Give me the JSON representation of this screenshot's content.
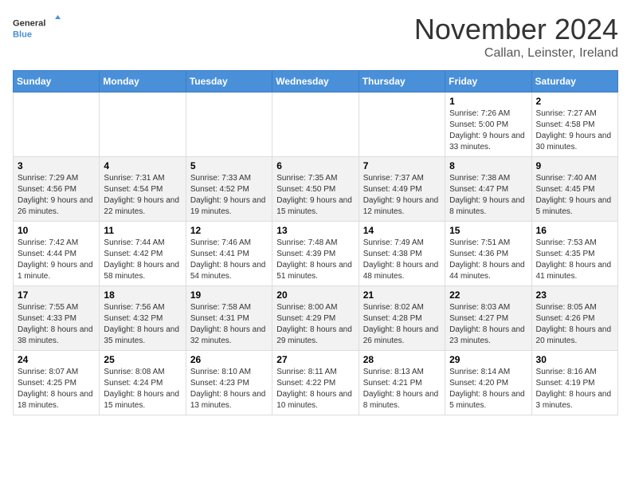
{
  "logo": {
    "line1": "General",
    "line2": "Blue"
  },
  "title": "November 2024",
  "subtitle": "Callan, Leinster, Ireland",
  "days_of_week": [
    "Sunday",
    "Monday",
    "Tuesday",
    "Wednesday",
    "Thursday",
    "Friday",
    "Saturday"
  ],
  "weeks": [
    [
      {
        "day": "",
        "info": ""
      },
      {
        "day": "",
        "info": ""
      },
      {
        "day": "",
        "info": ""
      },
      {
        "day": "",
        "info": ""
      },
      {
        "day": "",
        "info": ""
      },
      {
        "day": "1",
        "info": "Sunrise: 7:26 AM\nSunset: 5:00 PM\nDaylight: 9 hours and 33 minutes."
      },
      {
        "day": "2",
        "info": "Sunrise: 7:27 AM\nSunset: 4:58 PM\nDaylight: 9 hours and 30 minutes."
      }
    ],
    [
      {
        "day": "3",
        "info": "Sunrise: 7:29 AM\nSunset: 4:56 PM\nDaylight: 9 hours and 26 minutes."
      },
      {
        "day": "4",
        "info": "Sunrise: 7:31 AM\nSunset: 4:54 PM\nDaylight: 9 hours and 22 minutes."
      },
      {
        "day": "5",
        "info": "Sunrise: 7:33 AM\nSunset: 4:52 PM\nDaylight: 9 hours and 19 minutes."
      },
      {
        "day": "6",
        "info": "Sunrise: 7:35 AM\nSunset: 4:50 PM\nDaylight: 9 hours and 15 minutes."
      },
      {
        "day": "7",
        "info": "Sunrise: 7:37 AM\nSunset: 4:49 PM\nDaylight: 9 hours and 12 minutes."
      },
      {
        "day": "8",
        "info": "Sunrise: 7:38 AM\nSunset: 4:47 PM\nDaylight: 9 hours and 8 minutes."
      },
      {
        "day": "9",
        "info": "Sunrise: 7:40 AM\nSunset: 4:45 PM\nDaylight: 9 hours and 5 minutes."
      }
    ],
    [
      {
        "day": "10",
        "info": "Sunrise: 7:42 AM\nSunset: 4:44 PM\nDaylight: 9 hours and 1 minute."
      },
      {
        "day": "11",
        "info": "Sunrise: 7:44 AM\nSunset: 4:42 PM\nDaylight: 8 hours and 58 minutes."
      },
      {
        "day": "12",
        "info": "Sunrise: 7:46 AM\nSunset: 4:41 PM\nDaylight: 8 hours and 54 minutes."
      },
      {
        "day": "13",
        "info": "Sunrise: 7:48 AM\nSunset: 4:39 PM\nDaylight: 8 hours and 51 minutes."
      },
      {
        "day": "14",
        "info": "Sunrise: 7:49 AM\nSunset: 4:38 PM\nDaylight: 8 hours and 48 minutes."
      },
      {
        "day": "15",
        "info": "Sunrise: 7:51 AM\nSunset: 4:36 PM\nDaylight: 8 hours and 44 minutes."
      },
      {
        "day": "16",
        "info": "Sunrise: 7:53 AM\nSunset: 4:35 PM\nDaylight: 8 hours and 41 minutes."
      }
    ],
    [
      {
        "day": "17",
        "info": "Sunrise: 7:55 AM\nSunset: 4:33 PM\nDaylight: 8 hours and 38 minutes."
      },
      {
        "day": "18",
        "info": "Sunrise: 7:56 AM\nSunset: 4:32 PM\nDaylight: 8 hours and 35 minutes."
      },
      {
        "day": "19",
        "info": "Sunrise: 7:58 AM\nSunset: 4:31 PM\nDaylight: 8 hours and 32 minutes."
      },
      {
        "day": "20",
        "info": "Sunrise: 8:00 AM\nSunset: 4:29 PM\nDaylight: 8 hours and 29 minutes."
      },
      {
        "day": "21",
        "info": "Sunrise: 8:02 AM\nSunset: 4:28 PM\nDaylight: 8 hours and 26 minutes."
      },
      {
        "day": "22",
        "info": "Sunrise: 8:03 AM\nSunset: 4:27 PM\nDaylight: 8 hours and 23 minutes."
      },
      {
        "day": "23",
        "info": "Sunrise: 8:05 AM\nSunset: 4:26 PM\nDaylight: 8 hours and 20 minutes."
      }
    ],
    [
      {
        "day": "24",
        "info": "Sunrise: 8:07 AM\nSunset: 4:25 PM\nDaylight: 8 hours and 18 minutes."
      },
      {
        "day": "25",
        "info": "Sunrise: 8:08 AM\nSunset: 4:24 PM\nDaylight: 8 hours and 15 minutes."
      },
      {
        "day": "26",
        "info": "Sunrise: 8:10 AM\nSunset: 4:23 PM\nDaylight: 8 hours and 13 minutes."
      },
      {
        "day": "27",
        "info": "Sunrise: 8:11 AM\nSunset: 4:22 PM\nDaylight: 8 hours and 10 minutes."
      },
      {
        "day": "28",
        "info": "Sunrise: 8:13 AM\nSunset: 4:21 PM\nDaylight: 8 hours and 8 minutes."
      },
      {
        "day": "29",
        "info": "Sunrise: 8:14 AM\nSunset: 4:20 PM\nDaylight: 8 hours and 5 minutes."
      },
      {
        "day": "30",
        "info": "Sunrise: 8:16 AM\nSunset: 4:19 PM\nDaylight: 8 hours and 3 minutes."
      }
    ]
  ]
}
